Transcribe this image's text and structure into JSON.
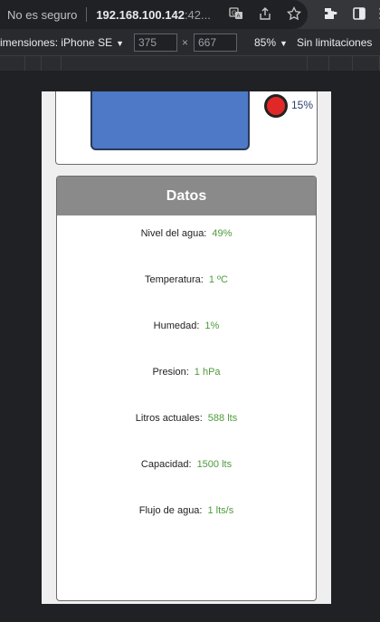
{
  "browser": {
    "security_label": "No es seguro",
    "url_host": "192.168.100.142",
    "url_rest": ":42...",
    "icons": [
      "translate-icon",
      "share-icon",
      "bookmark-star-icon",
      "extensions-puzzle-icon",
      "side-panel-icon",
      "more-vert-icon"
    ]
  },
  "device_toolbar": {
    "dimensions_label": "imensiones: iPhone SE",
    "width": "375",
    "height": "667",
    "times": "×",
    "zoom": "85%",
    "throttle": "Sin limitaciones"
  },
  "app": {
    "tank_percent": "15%",
    "indicator_color": "#e02828",
    "tank_color": "#4d79c7",
    "datos": {
      "title": "Datos",
      "rows": [
        {
          "label": "Nivel del agua:",
          "value": "49%"
        },
        {
          "label": "Temperatura:",
          "value": "1 ºC"
        },
        {
          "label": "Humedad:",
          "value": "1%"
        },
        {
          "label": "Presion:",
          "value": "1 hPa"
        },
        {
          "label": "Litros actuales:",
          "value": "588 lts"
        },
        {
          "label": "Capacidad:",
          "value": "1500 lts"
        },
        {
          "label": "Flujo de agua:",
          "value": "1 lts/s"
        }
      ]
    }
  }
}
